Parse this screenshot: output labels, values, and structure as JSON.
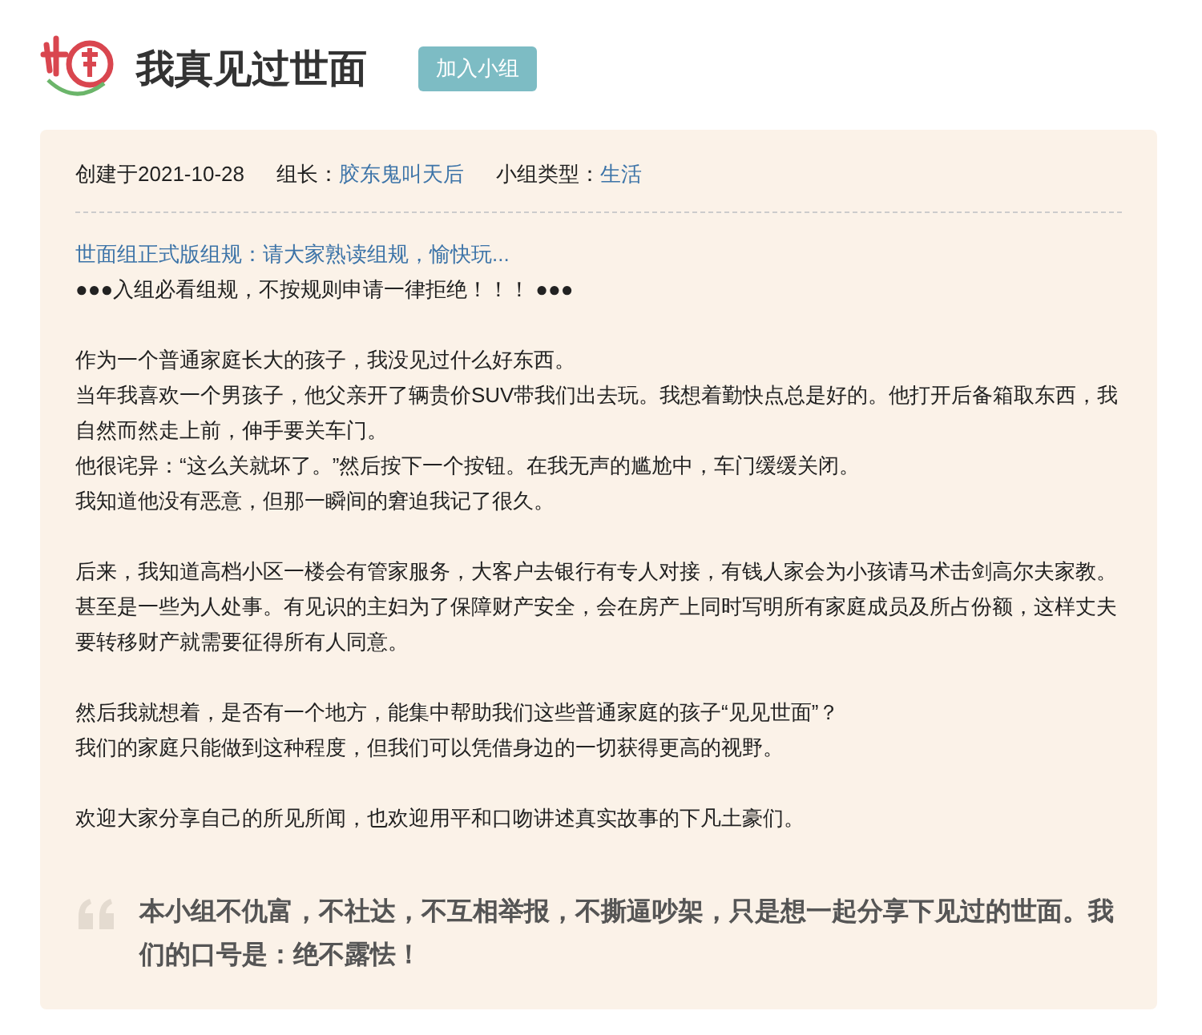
{
  "header": {
    "title": "我真见过世面",
    "join_button": "加入小组"
  },
  "meta": {
    "created": "创建于2021-10-28",
    "owner_label": "组长：",
    "owner": "胶东鬼叫天后",
    "type_label": "小组类型：",
    "type": "生活"
  },
  "rules_link": "世面组正式版组规：请大家熟读组规，愉快玩...",
  "paragraphs": [
    [
      "●●●入组必看组规，不按规则申请一律拒绝！！！ ●●●"
    ],
    [
      "作为一个普通家庭长大的孩子，我没见过什么好东西。",
      "当年我喜欢一个男孩子，他父亲开了辆贵价SUV带我们出去玩。我想着勤快点总是好的。他打开后备箱取东西，我自然而然走上前，伸手要关车门。",
      "他很诧异：“这么关就坏了。”然后按下一个按钮。在我无声的尴尬中，车门缓缓关闭。",
      "我知道他没有恶意，但那一瞬间的窘迫我记了很久。"
    ],
    [
      "后来，我知道高档小区一楼会有管家服务，大客户去银行有专人对接，有钱人家会为小孩请马术击剑高尔夫家教。",
      "甚至是一些为人处事。有见识的主妇为了保障财产安全，会在房产上同时写明所有家庭成员及所占份额，这样丈夫要转移财产就需要征得所有人同意。"
    ],
    [
      "然后我就想着，是否有一个地方，能集中帮助我们这些普通家庭的孩子“见见世面”？",
      "我们的家庭只能做到这种程度，但我们可以凭借身边的一切获得更高的视野。"
    ],
    [
      "欢迎大家分享自己的所见所闻，也欢迎用平和口吻讲述真实故事的下凡土豪们。"
    ]
  ],
  "quote": "本小组不仇富，不社达，不互相举报，不撕逼吵架，只是想一起分享下见过的世面。我们的口号是：绝不露怯！"
}
